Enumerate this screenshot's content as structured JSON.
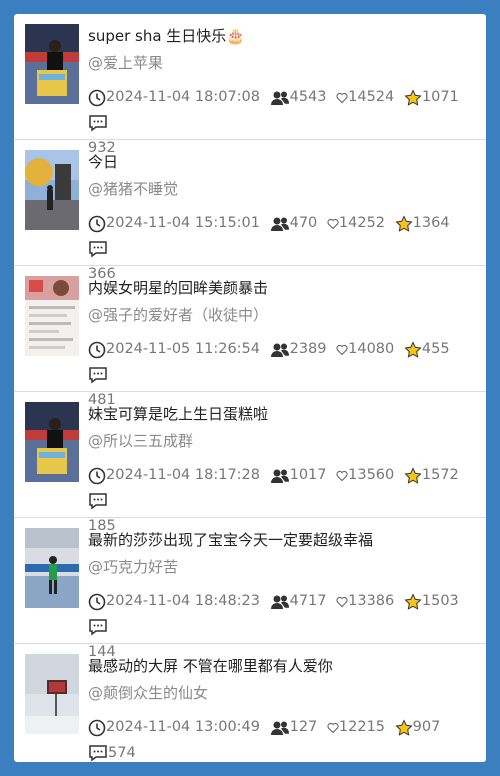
{
  "items": [
    {
      "title": "super sha 生日快乐🎂",
      "author": "@爱上苹果",
      "time": "2024-11-04 18:07:08",
      "views": "4543",
      "likes": "14524",
      "stars": "1071",
      "comments": "932"
    },
    {
      "title": "今日",
      "author": "@猪猪不睡觉",
      "time": "2024-11-04 15:15:01",
      "views": "470",
      "likes": "14252",
      "stars": "1364",
      "comments": "366"
    },
    {
      "title": "内娱女明星的回眸美颜暴击",
      "author": "@强子的爱好者（收徒中）",
      "time": "2024-11-05 11:26:54",
      "views": "2389",
      "likes": "14080",
      "stars": "455",
      "comments": "481"
    },
    {
      "title": "妹宝可算是吃上生日蛋糕啦",
      "author": "@所以三五成群",
      "time": "2024-11-04 18:17:28",
      "views": "1017",
      "likes": "13560",
      "stars": "1572",
      "comments": "185"
    },
    {
      "title": "最新的莎莎出现了宝宝今天一定要超级幸福",
      "author": "@巧克力好苦",
      "time": "2024-11-04 18:48:23",
      "views": "4717",
      "likes": "13386",
      "stars": "1503",
      "comments": "144"
    },
    {
      "title": "最感动的大屏 不管在哪里都有人爱你",
      "author": "@颠倒众生的仙女",
      "time": "2024-11-04 13:00:49",
      "views": "127",
      "likes": "12215",
      "stars": "907",
      "comments": "574"
    }
  ],
  "colors": {
    "background": "#3b7fc1",
    "star": "#f5c518",
    "meta_text": "#777777",
    "author_text": "#8a8a8a"
  },
  "icons": [
    "clock-icon",
    "users-icon",
    "heart-icon",
    "star-icon",
    "comment-icon"
  ]
}
